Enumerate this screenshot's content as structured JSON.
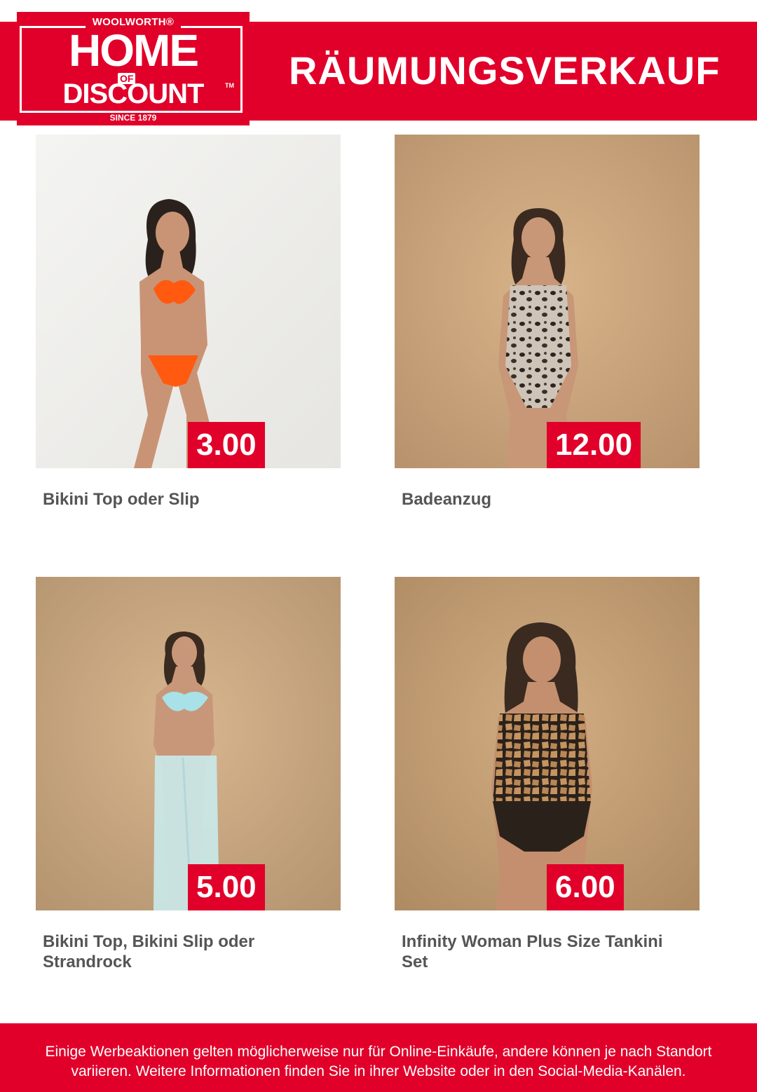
{
  "header": {
    "logo": {
      "brand": "WOOLWORTH®",
      "home": "HOME",
      "of": "OF",
      "discount": "DISCOUNT",
      "tm": "TM",
      "since": "SINCE 1879"
    },
    "headline": "RÄUMUNGSVERKAUF"
  },
  "products": [
    {
      "name": "Bikini Top oder Slip",
      "price": "3.00",
      "image": "woman-orange-bikini"
    },
    {
      "name": "Badeanzug",
      "price": "12.00",
      "image": "woman-leopard-swimsuit"
    },
    {
      "name": "Bikini Top, Bikini Slip oder Strandrock",
      "price": "5.00",
      "image": "woman-mint-bikini-sarong"
    },
    {
      "name": "Infinity Woman Plus Size Tankini Set",
      "price": "6.00",
      "image": "woman-giraffe-tankini"
    }
  ],
  "footer": {
    "disclaimer": "Einige Werbeaktionen gelten möglicherweise nur für Online-Einkäufe, andere können je nach Standort variieren. Weitere Informationen finden Sie in ihrer Website oder in den Social-Media-Kanälen."
  },
  "colors": {
    "brand_red": "#e1002a",
    "title_gray": "#555555",
    "white": "#ffffff"
  }
}
